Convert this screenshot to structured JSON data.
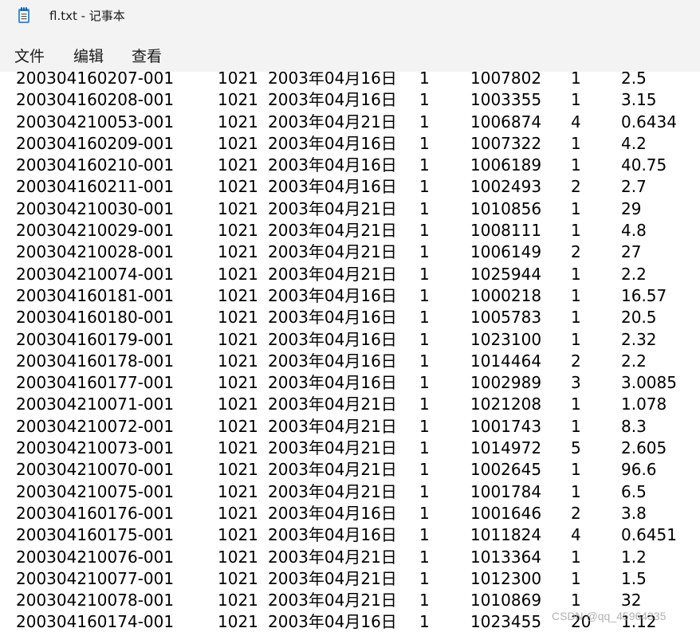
{
  "window": {
    "title": "fl.txt - 记事本",
    "icon": "notepad-icon"
  },
  "menu": {
    "items": [
      {
        "label": "文件"
      },
      {
        "label": "编辑"
      },
      {
        "label": "查看"
      }
    ]
  },
  "rows": [
    [
      "200304160207-001",
      "1021",
      "2003年04月16日",
      "1",
      "1007802",
      "1",
      "2.5"
    ],
    [
      "200304160208-001",
      "1021",
      "2003年04月16日",
      "1",
      "1003355",
      "1",
      "3.15"
    ],
    [
      "200304210053-001",
      "1021",
      "2003年04月21日",
      "1",
      "1006874",
      "4",
      "0.6434"
    ],
    [
      "200304160209-001",
      "1021",
      "2003年04月16日",
      "1",
      "1007322",
      "1",
      "4.2"
    ],
    [
      "200304160210-001",
      "1021",
      "2003年04月16日",
      "1",
      "1006189",
      "1",
      "40.75"
    ],
    [
      "200304160211-001",
      "1021",
      "2003年04月16日",
      "1",
      "1002493",
      "2",
      "2.7"
    ],
    [
      "200304210030-001",
      "1021",
      "2003年04月21日",
      "1",
      "1010856",
      "1",
      "29"
    ],
    [
      "200304210029-001",
      "1021",
      "2003年04月21日",
      "1",
      "1008111",
      "1",
      "4.8"
    ],
    [
      "200304210028-001",
      "1021",
      "2003年04月21日",
      "1",
      "1006149",
      "2",
      "27"
    ],
    [
      "200304210074-001",
      "1021",
      "2003年04月21日",
      "1",
      "1025944",
      "1",
      "2.2"
    ],
    [
      "200304160181-001",
      "1021",
      "2003年04月16日",
      "1",
      "1000218",
      "1",
      "16.57"
    ],
    [
      "200304160180-001",
      "1021",
      "2003年04月16日",
      "1",
      "1005783",
      "1",
      "20.5"
    ],
    [
      "200304160179-001",
      "1021",
      "2003年04月16日",
      "1",
      "1023100",
      "1",
      "2.32"
    ],
    [
      "200304160178-001",
      "1021",
      "2003年04月16日",
      "1",
      "1014464",
      "2",
      "2.2"
    ],
    [
      "200304160177-001",
      "1021",
      "2003年04月16日",
      "1",
      "1002989",
      "3",
      "3.0085"
    ],
    [
      "200304210071-001",
      "1021",
      "2003年04月21日",
      "1",
      "1021208",
      "1",
      "1.078"
    ],
    [
      "200304210072-001",
      "1021",
      "2003年04月21日",
      "1",
      "1001743",
      "1",
      "8.3"
    ],
    [
      "200304210073-001",
      "1021",
      "2003年04月21日",
      "1",
      "1014972",
      "5",
      "2.605"
    ],
    [
      "200304210070-001",
      "1021",
      "2003年04月21日",
      "1",
      "1002645",
      "1",
      "96.6"
    ],
    [
      "200304210075-001",
      "1021",
      "2003年04月21日",
      "1",
      "1001784",
      "1",
      "6.5"
    ],
    [
      "200304160176-001",
      "1021",
      "2003年04月16日",
      "1",
      "1001646",
      "2",
      "3.8"
    ],
    [
      "200304160175-001",
      "1021",
      "2003年04月16日",
      "1",
      "1011824",
      "4",
      "0.6451"
    ],
    [
      "200304210076-001",
      "1021",
      "2003年04月21日",
      "1",
      "1013364",
      "1",
      "1.2"
    ],
    [
      "200304210077-001",
      "1021",
      "2003年04月21日",
      "1",
      "1012300",
      "1",
      "1.5"
    ],
    [
      "200304210078-001",
      "1021",
      "2003年04月21日",
      "1",
      "1010869",
      "1",
      "32"
    ],
    [
      "200304160174-001",
      "1021",
      "2003年04月16日",
      "1",
      "1023455",
      "20",
      "1.12"
    ]
  ],
  "watermark": "CSDN @qq_45964335"
}
